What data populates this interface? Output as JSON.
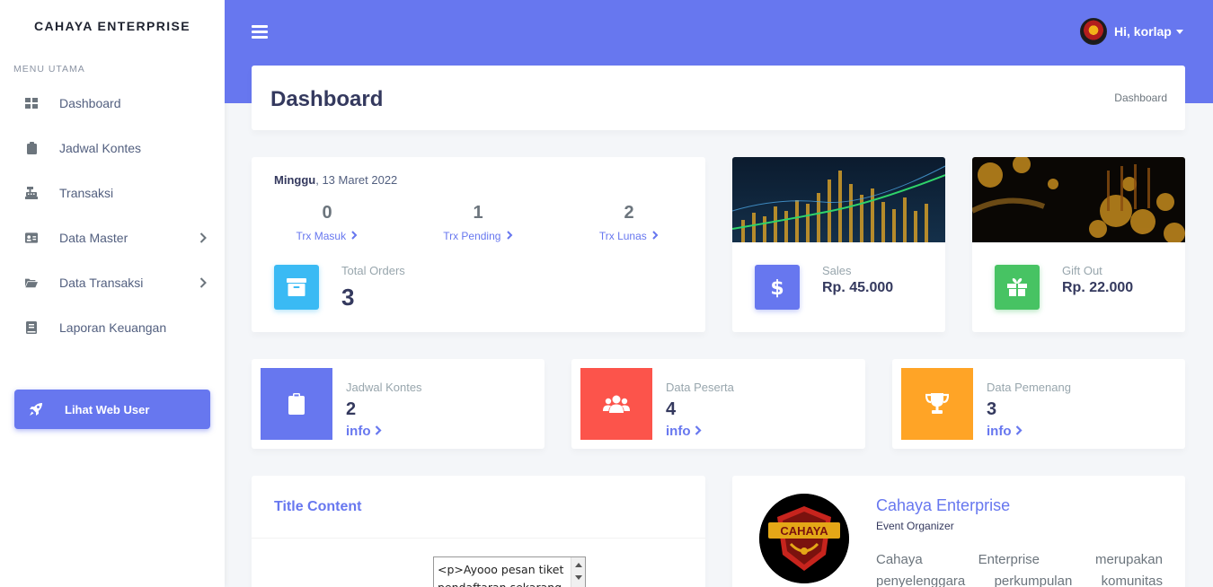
{
  "sidebar": {
    "brand": "CAHAYA ENTERPRISE",
    "menu_header": "MENU UTAMA",
    "items": [
      {
        "label": "Dashboard",
        "icon": "th-large-icon"
      },
      {
        "label": "Jadwal Kontes",
        "icon": "clipboard-icon"
      },
      {
        "label": "Transaksi",
        "icon": "cash-register-icon"
      },
      {
        "label": "Data Master",
        "icon": "id-card-icon",
        "has_submenu": true
      },
      {
        "label": "Data Transaksi",
        "icon": "folder-open-icon",
        "has_submenu": true
      },
      {
        "label": "Laporan Keuangan",
        "icon": "book-icon"
      }
    ],
    "web_button": "Lihat Web User"
  },
  "topbar": {
    "greeting": "Hi, korlap"
  },
  "page": {
    "title": "Dashboard",
    "breadcrumb": "Dashboard"
  },
  "stats": {
    "day": "Minggu",
    "date": ", 13 Maret 2022",
    "trx": [
      {
        "value": "0",
        "label": "Trx Masuk"
      },
      {
        "value": "1",
        "label": "Trx Pending"
      },
      {
        "value": "2",
        "label": "Trx Lunas"
      }
    ],
    "total_orders_label": "Total Orders",
    "total_orders_value": "3",
    "sales_label": "Sales",
    "sales_value": "Rp. 45.000",
    "gift_label": "Gift Out",
    "gift_value": "Rp. 22.000"
  },
  "mini_cards": [
    {
      "title": "Jadwal Kontes",
      "value": "2",
      "link": "info",
      "color": "#6777ef",
      "icon": "clipboard-icon"
    },
    {
      "title": "Data Peserta",
      "value": "4",
      "link": "info",
      "color": "#fc544b",
      "icon": "users-icon"
    },
    {
      "title": "Data Pemenang",
      "value": "3",
      "link": "info",
      "color": "#ffa426",
      "icon": "trophy-icon"
    }
  ],
  "content": {
    "title": "Title Content",
    "textarea_line1": "<p>Ayooo pesan tiket",
    "textarea_line2": "pendaftaran sekarang"
  },
  "profile": {
    "name": "Cahaya Enterprise",
    "subtitle": "Event Organizer",
    "desc_line1": "Cahaya Enterprise merupakan",
    "desc_line2": "penyelenggara perkumpulan komunitas",
    "logo_text": "CAHAYA"
  },
  "colors": {
    "primary": "#6777ef",
    "info": "#3abaf4",
    "success": "#47c363",
    "danger": "#fc544b",
    "warning": "#ffa426"
  }
}
